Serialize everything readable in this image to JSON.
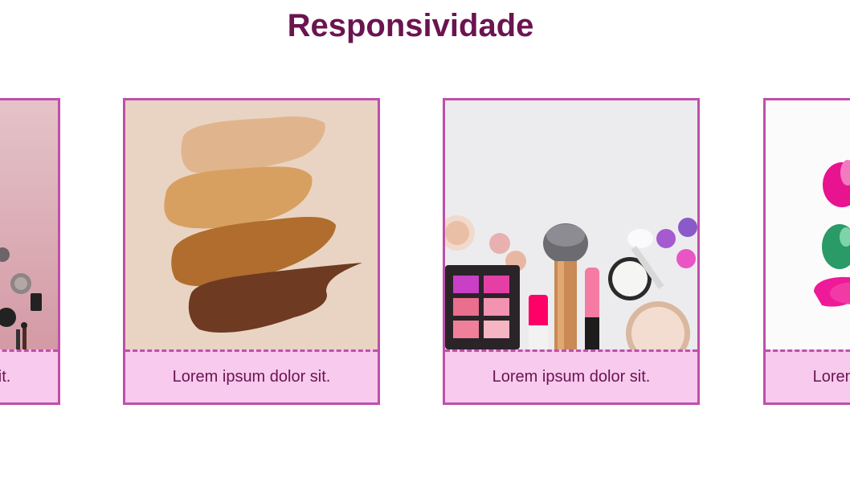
{
  "page": {
    "title": "Responsividade"
  },
  "carousel": {
    "cards": [
      {
        "caption": "Lorem ipsum dolor sit.",
        "image": "makeup-pink-background"
      },
      {
        "caption": "Lorem ipsum dolor sit.",
        "image": "foundation-swatches"
      },
      {
        "caption": "Lorem ipsum dolor sit.",
        "image": "makeup-brush-palette"
      },
      {
        "caption": "Lorem ipsum dolor sit.",
        "image": "pink-nail-polish"
      }
    ]
  },
  "colors": {
    "title": "#6b1450",
    "card_border": "#c04fa9",
    "card_caption_bg": "#f7caee",
    "caption_text": "#6b1450"
  }
}
